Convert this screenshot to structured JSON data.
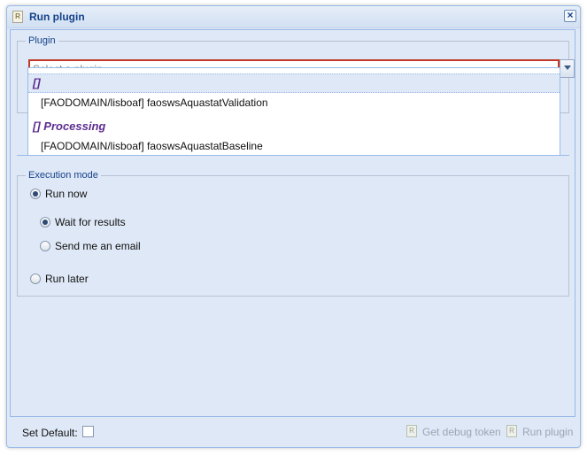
{
  "window": {
    "title": "Run plugin"
  },
  "plugin": {
    "legend": "Plugin",
    "placeholder": "Select a plugin",
    "groups": [
      {
        "header": "[]",
        "items": [
          "[FAODOMAIN/lisboaf] faoswsAquastatValidation"
        ]
      },
      {
        "header": "[] Processing",
        "items": [
          "[FAODOMAIN/lisboaf] faoswsAquastatBaseline"
        ]
      }
    ]
  },
  "execution": {
    "legend": "Execution mode",
    "run_now": "Run now",
    "wait_for_results": "Wait for results",
    "send_email": "Send me an email",
    "run_later": "Run later",
    "selected_mode": "Run now",
    "selected_notify": "Wait for results"
  },
  "footer": {
    "set_default": "Set Default:",
    "get_debug_token": "Get debug token",
    "run_plugin": "Run plugin"
  }
}
